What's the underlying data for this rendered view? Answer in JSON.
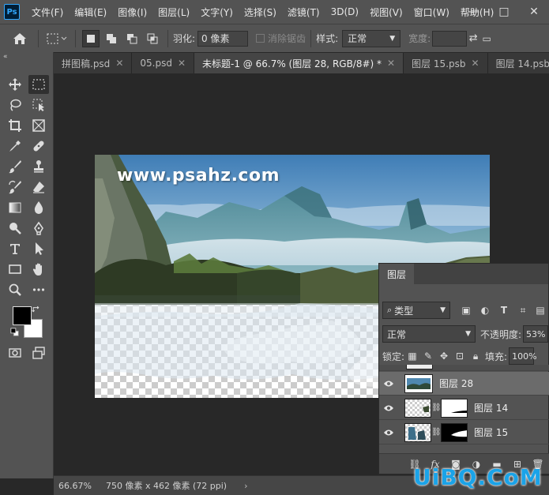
{
  "app": {
    "logo": "Ps",
    "menu": [
      "文件(F)",
      "编辑(E)",
      "图像(I)",
      "图层(L)",
      "文字(Y)",
      "选择(S)",
      "滤镜(T)",
      "3D(D)",
      "视图(V)",
      "窗口(W)",
      "帮助(H)"
    ],
    "window_controls": [
      "—",
      "□",
      "✕"
    ]
  },
  "options": {
    "feather_label": "羽化:",
    "feather_value": "0 像素",
    "antialias_label": "消除锯齿",
    "style_label": "样式:",
    "style_value": "正常",
    "width_label": "宽度:"
  },
  "tabs": [
    {
      "label": "拼图稿.psd",
      "active": false
    },
    {
      "label": "05.psd",
      "active": false
    },
    {
      "label": "未标题-1 @ 66.7% (图层 28, RGB/8#) *",
      "active": true
    },
    {
      "label": "图层 15.psb",
      "active": false
    },
    {
      "label": "图层 14.psb",
      "active": false
    }
  ],
  "canvas": {
    "watermark": "www.psahz.com"
  },
  "status": {
    "zoom": "66.67%",
    "doc_info": "750 像素 x 462 像素 (72 ppi)",
    "arrow": "›"
  },
  "layers_panel": {
    "title": "图层",
    "filter_value": "类型",
    "blend_mode": "正常",
    "opacity_label": "不透明度:",
    "opacity_value": "53%",
    "lock_label": "锁定:",
    "fill_label": "填充:",
    "fill_value": "100%",
    "layers": [
      {
        "name": "图层 28",
        "selected": true,
        "has_mask": false
      },
      {
        "name": "图层 14",
        "selected": false,
        "has_mask": true
      },
      {
        "name": "图层 15",
        "selected": false,
        "has_mask": true
      }
    ]
  },
  "site_watermark": "UiBQ.CoM",
  "colors": {
    "accent": "#31a8ff",
    "panel": "#535353",
    "workspace": "#282828",
    "site_watermark": "#1aa3e8"
  }
}
